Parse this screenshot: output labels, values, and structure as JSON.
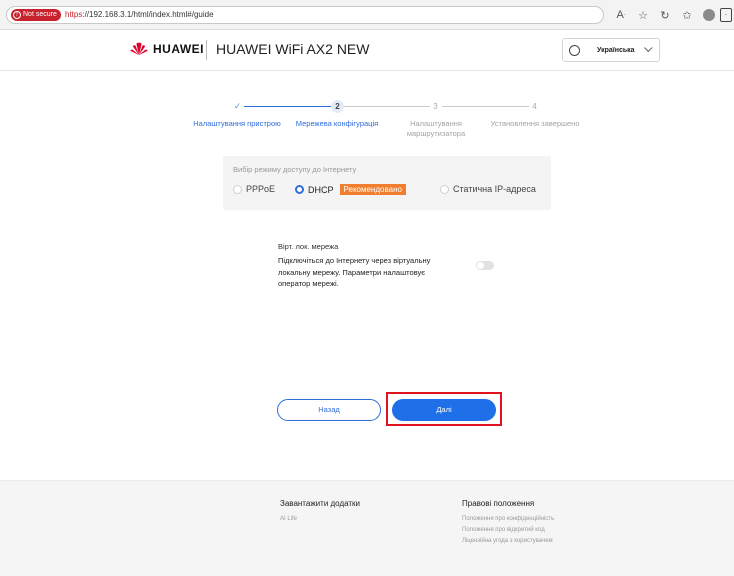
{
  "browser": {
    "not_secure_label": "Not secure",
    "url_scheme": "https:",
    "url_rest": "//192.168.3.1/html/index.html#/guide",
    "icons": [
      "read-aloud-icon",
      "favorite-icon",
      "refresh-icon",
      "favorites-list-icon",
      "profile-icon",
      "sidebar-icon"
    ]
  },
  "header": {
    "logo_text": "HUAWEI",
    "product_name": "HUAWEI WiFi AX2 NEW",
    "language": "Українська"
  },
  "stepper": {
    "steps": [
      {
        "label": "Налаштування пристрою",
        "marker": "✓",
        "state": "done"
      },
      {
        "label": "Мережева конфігурація",
        "marker": "2",
        "state": "current"
      },
      {
        "label": "Налаштування\nмаршрутизатора",
        "marker": "3",
        "state": "todo"
      },
      {
        "label": "Установлення завершено",
        "marker": "4",
        "state": "todo"
      }
    ]
  },
  "access_mode": {
    "title": "Вибір режиму доступу до Інтернету",
    "options": [
      {
        "label": "PPPoE",
        "selected": false
      },
      {
        "label": "DHCP",
        "selected": true,
        "badge": "Рекомендовано"
      },
      {
        "label": "Статична IP-адреса",
        "selected": false
      }
    ]
  },
  "vlan": {
    "title": "Вірт. лок. мережа",
    "description": "Підключіться до Інтернету через віртуальну локальну мережу. Параметри налаштовує оператор мережі.",
    "enabled": false
  },
  "buttons": {
    "back": "Назад",
    "next": "Далі"
  },
  "footer": {
    "apps": {
      "heading": "Завантажити додатки",
      "links": [
        "AI Life"
      ]
    },
    "legal": {
      "heading": "Правові положення",
      "links": [
        "Положення про конфіденційність",
        "Положення про відкритий код",
        "Ліцензійна угода з користувачем"
      ]
    }
  },
  "colors": {
    "accent": "#1e6fe8",
    "badge": "#f07e2e",
    "highlight": "#e0141e",
    "not_secure": "#c8232c"
  }
}
